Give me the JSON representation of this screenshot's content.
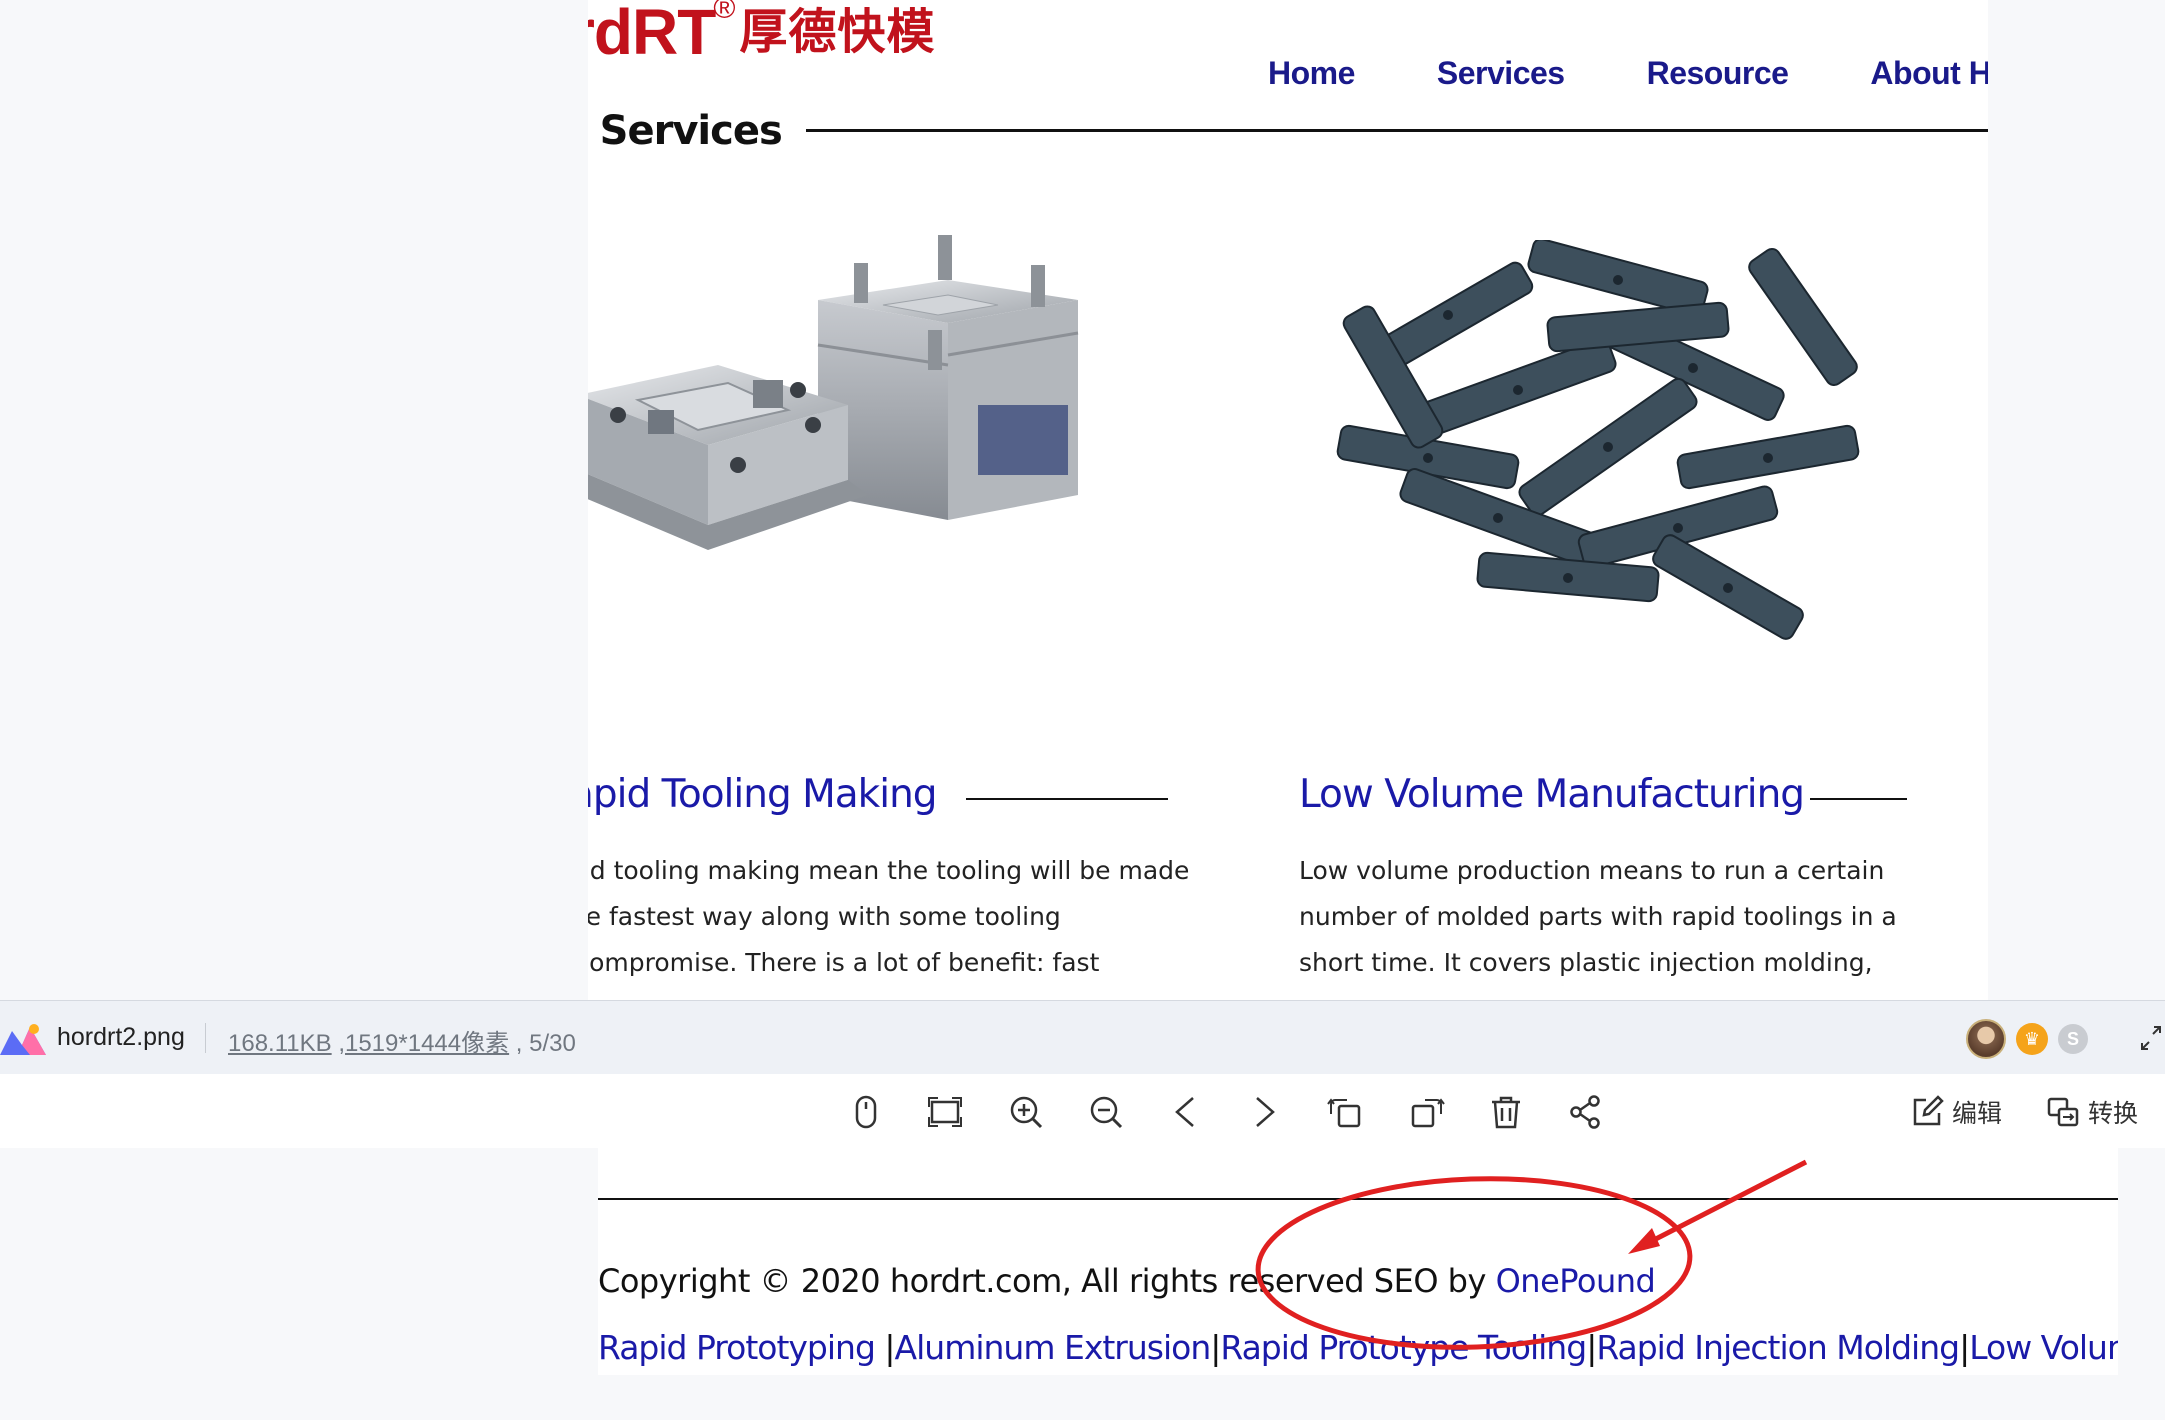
{
  "site": {
    "logo_latin": "rdRT",
    "logo_registered": "®",
    "logo_chinese": "厚德快模",
    "nav": [
      "Home",
      "Services",
      "Resource",
      "About Hor"
    ],
    "section_heading": "r Services",
    "cards": [
      {
        "title": "apid Tooling Making",
        "image": "mold-tooling-photo",
        "lines": [
          "ıpid tooling making mean the tooling will be made",
          "the fastest way along with some tooling",
          "ecompromise. There is a lot of benefit: fast"
        ]
      },
      {
        "title": "Low Volume Manufacturing",
        "image": "molded-parts-pile-photo",
        "lines": [
          "Low volume production means to run a certain",
          "number of molded parts with rapid toolings in a",
          "short time. It covers plastic injection molding,"
        ]
      }
    ]
  },
  "viewer": {
    "filename": "hordrt2.png",
    "filesize": "168.11KB",
    "dimensions": "1519*1444像素",
    "position": "5/30",
    "edit_label": "编辑",
    "convert_label": "转换",
    "tools": [
      "mouse-icon",
      "fit-screen-icon",
      "zoom-in-icon",
      "zoom-out-icon",
      "previous-icon",
      "next-icon",
      "rotate-left-icon",
      "rotate-right-icon",
      "delete-icon",
      "share-icon"
    ]
  },
  "footer": {
    "copyright_prefix": "Copyright © 2020 hordrt.com, All rights reserved SEO by ",
    "copyright_brand": "OnePound",
    "links": [
      "Rapid Prototyping ",
      "Aluminum Extrusion",
      "Rapid Prototype Tooling",
      "Rapid Injection Molding",
      "Low Volume P"
    ]
  },
  "colors": {
    "brand_red": "#c1121c",
    "link_blue": "#1a1aa8",
    "annotation_red": "#e02020"
  }
}
